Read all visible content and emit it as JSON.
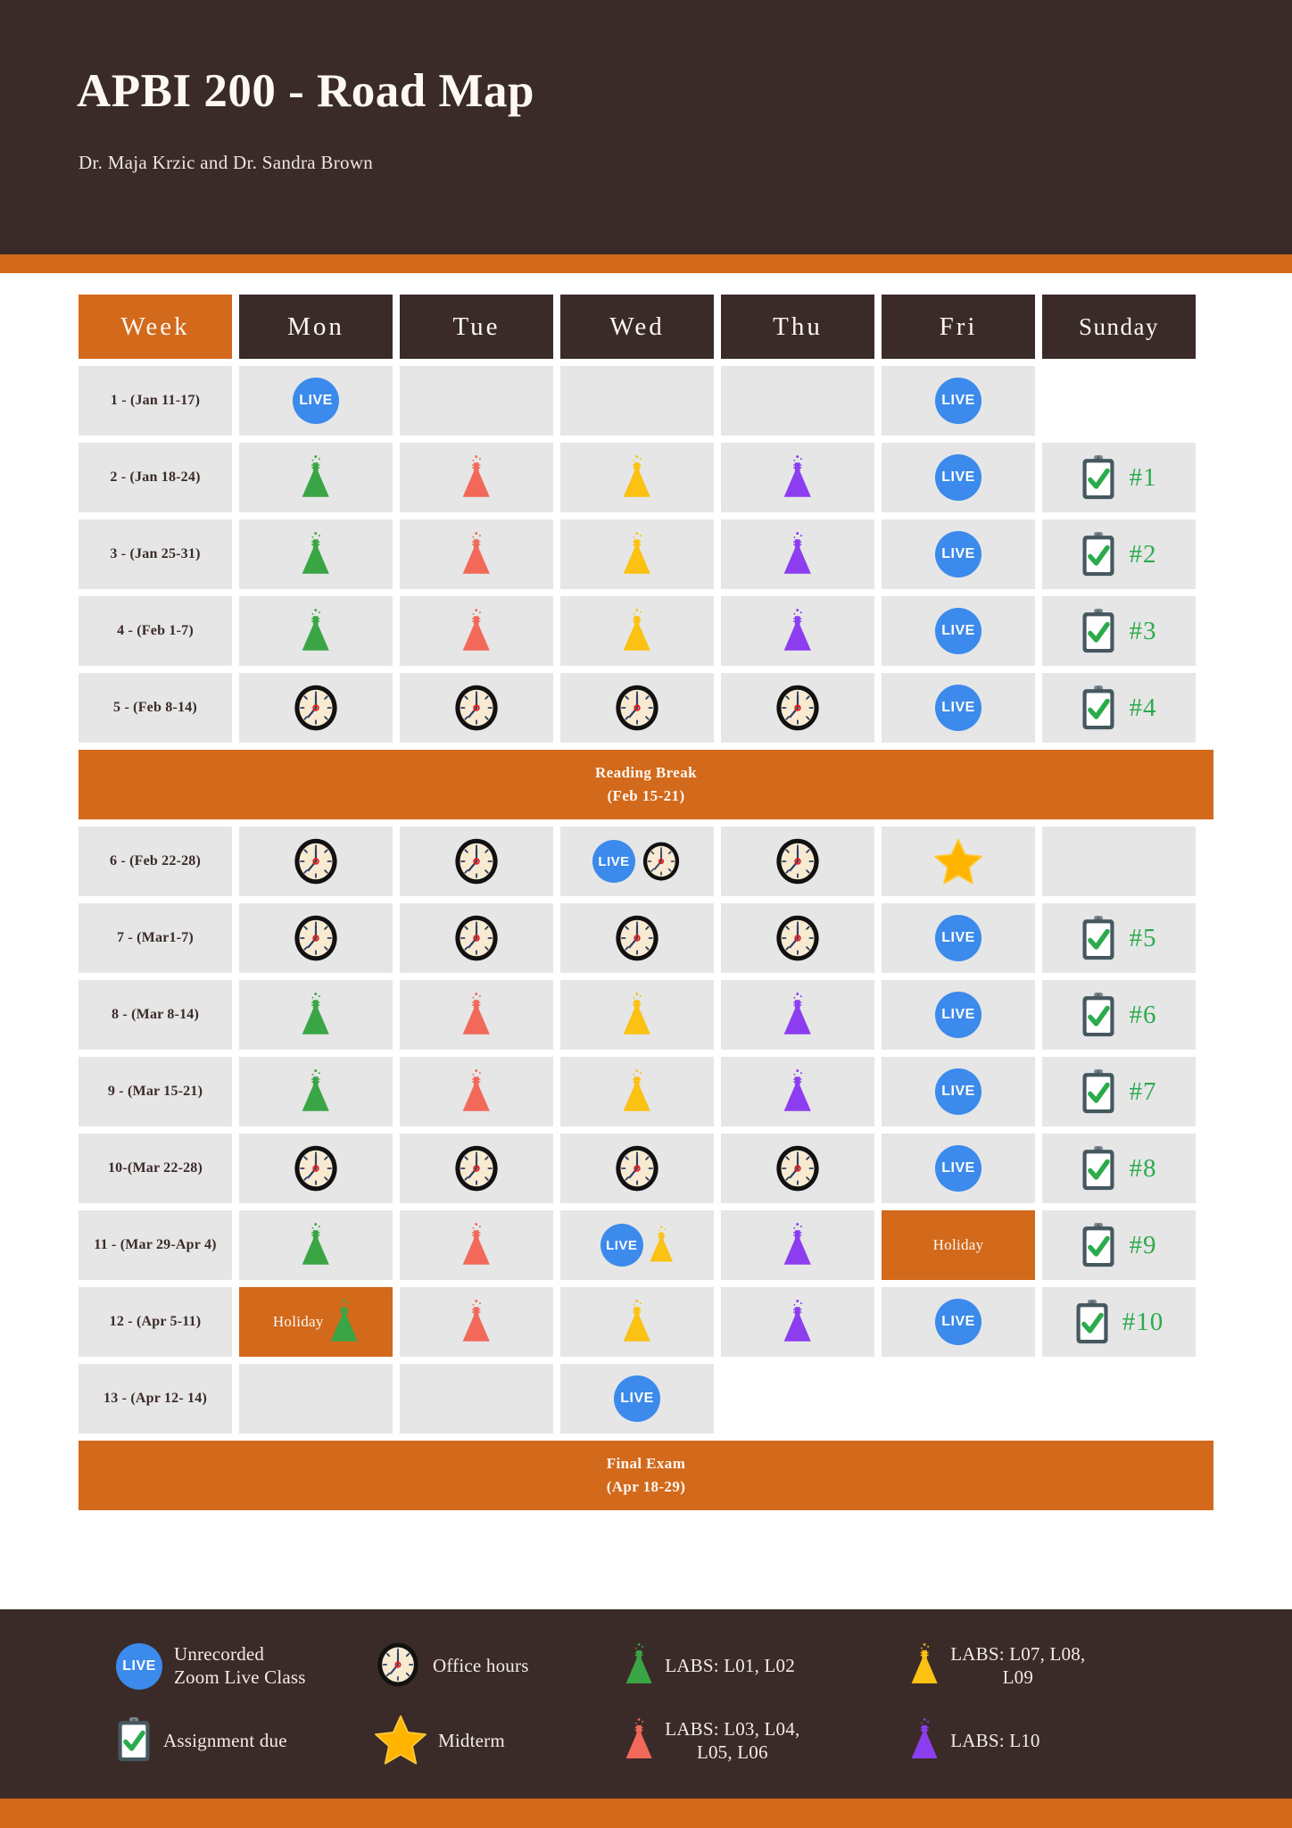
{
  "header": {
    "title": "APBI 200 - Road Map",
    "subtitle": "Dr. Maja Krzic and Dr. Sandra Brown"
  },
  "colors": {
    "brand_dark": "#3b2b28",
    "brand_orange": "#d2691b",
    "cell_gray": "#e6e6e6",
    "live_blue": "#3b8aec",
    "assignment_green": "#2bab4c",
    "flask_green": "#3aa545",
    "flask_red": "#f2695a",
    "flask_yellow": "#fbc113",
    "flask_purple": "#8c3df0",
    "star_yellow": "#ffb400"
  },
  "table": {
    "columns": [
      "Week",
      "Mon",
      "Tue",
      "Wed",
      "Thu",
      "Fri",
      "Sunday"
    ],
    "rows": [
      {
        "week": "1 - (Jan 11-17)",
        "cells": [
          {
            "icons": [
              "live"
            ]
          },
          {
            "icons": []
          },
          {
            "icons": []
          },
          {
            "icons": []
          },
          {
            "icons": [
              "live"
            ]
          },
          {
            "icons": [],
            "blank": true
          }
        ]
      },
      {
        "week": "2 - (Jan 18-24)",
        "cells": [
          {
            "icons": [
              "flask-green"
            ]
          },
          {
            "icons": [
              "flask-red"
            ]
          },
          {
            "icons": [
              "flask-yellow"
            ]
          },
          {
            "icons": [
              "flask-purple"
            ]
          },
          {
            "icons": [
              "live"
            ]
          },
          {
            "icons": [
              "clipboard"
            ],
            "assignment": "#1"
          }
        ]
      },
      {
        "week": "3 - (Jan 25-31)",
        "cells": [
          {
            "icons": [
              "flask-green"
            ]
          },
          {
            "icons": [
              "flask-red"
            ]
          },
          {
            "icons": [
              "flask-yellow"
            ]
          },
          {
            "icons": [
              "flask-purple"
            ]
          },
          {
            "icons": [
              "live"
            ]
          },
          {
            "icons": [
              "clipboard"
            ],
            "assignment": "#2"
          }
        ]
      },
      {
        "week": "4 - (Feb 1-7)",
        "cells": [
          {
            "icons": [
              "flask-green"
            ]
          },
          {
            "icons": [
              "flask-red"
            ]
          },
          {
            "icons": [
              "flask-yellow"
            ]
          },
          {
            "icons": [
              "flask-purple"
            ]
          },
          {
            "icons": [
              "live"
            ]
          },
          {
            "icons": [
              "clipboard"
            ],
            "assignment": "#3"
          }
        ]
      },
      {
        "week": "5 - (Feb 8-14)",
        "cells": [
          {
            "icons": [
              "clock"
            ]
          },
          {
            "icons": [
              "clock"
            ]
          },
          {
            "icons": [
              "clock"
            ]
          },
          {
            "icons": [
              "clock"
            ]
          },
          {
            "icons": [
              "live"
            ]
          },
          {
            "icons": [
              "clipboard"
            ],
            "assignment": "#4"
          }
        ]
      }
    ],
    "reading_break": {
      "line1": "Reading Break",
      "line2": "(Feb 15-21)"
    },
    "rows2": [
      {
        "week": "6 - (Feb 22-28)",
        "cells": [
          {
            "icons": [
              "clock"
            ]
          },
          {
            "icons": [
              "clock"
            ]
          },
          {
            "icons": [
              "live",
              "clock"
            ]
          },
          {
            "icons": [
              "clock"
            ]
          },
          {
            "icons": [
              "star"
            ]
          },
          {
            "icons": []
          }
        ]
      },
      {
        "week": "7 - (Mar1-7)",
        "cells": [
          {
            "icons": [
              "clock"
            ]
          },
          {
            "icons": [
              "clock"
            ]
          },
          {
            "icons": [
              "clock"
            ]
          },
          {
            "icons": [
              "clock"
            ]
          },
          {
            "icons": [
              "live"
            ]
          },
          {
            "icons": [
              "clipboard"
            ],
            "assignment": "#5"
          }
        ]
      },
      {
        "week": "8 - (Mar 8-14)",
        "cells": [
          {
            "icons": [
              "flask-green"
            ]
          },
          {
            "icons": [
              "flask-red"
            ]
          },
          {
            "icons": [
              "flask-yellow"
            ]
          },
          {
            "icons": [
              "flask-purple"
            ]
          },
          {
            "icons": [
              "live"
            ]
          },
          {
            "icons": [
              "clipboard"
            ],
            "assignment": "#6"
          }
        ]
      },
      {
        "week": "9 - (Mar 15-21)",
        "cells": [
          {
            "icons": [
              "flask-green"
            ]
          },
          {
            "icons": [
              "flask-red"
            ]
          },
          {
            "icons": [
              "flask-yellow"
            ]
          },
          {
            "icons": [
              "flask-purple"
            ]
          },
          {
            "icons": [
              "live"
            ]
          },
          {
            "icons": [
              "clipboard"
            ],
            "assignment": "#7"
          }
        ]
      },
      {
        "week": "10-(Mar 22-28)",
        "cells": [
          {
            "icons": [
              "clock"
            ]
          },
          {
            "icons": [
              "clock"
            ]
          },
          {
            "icons": [
              "clock"
            ]
          },
          {
            "icons": [
              "clock"
            ]
          },
          {
            "icons": [
              "live"
            ]
          },
          {
            "icons": [
              "clipboard"
            ],
            "assignment": "#8"
          }
        ]
      },
      {
        "week": "11 - (Mar 29-Apr 4)",
        "cells": [
          {
            "icons": [
              "flask-green"
            ]
          },
          {
            "icons": [
              "flask-red"
            ]
          },
          {
            "icons": [
              "live",
              "flask-yellow"
            ]
          },
          {
            "icons": [
              "flask-purple"
            ]
          },
          {
            "icons": [],
            "holiday": "Holiday"
          },
          {
            "icons": [
              "clipboard"
            ],
            "assignment": "#9"
          }
        ]
      },
      {
        "week": "12 - (Apr 5-11)",
        "cells": [
          {
            "icons": [
              "flask-green"
            ],
            "holiday": "Holiday"
          },
          {
            "icons": [
              "flask-red"
            ]
          },
          {
            "icons": [
              "flask-yellow"
            ]
          },
          {
            "icons": [
              "flask-purple"
            ]
          },
          {
            "icons": [
              "live"
            ]
          },
          {
            "icons": [
              "clipboard"
            ],
            "assignment": "#10"
          }
        ]
      },
      {
        "week": "13 - (Apr 12- 14)",
        "cells": [
          {
            "icons": []
          },
          {
            "icons": []
          },
          {
            "icons": [
              "live"
            ]
          },
          {
            "icons": [],
            "blank": true
          },
          {
            "icons": [],
            "blank": true
          },
          {
            "icons": [],
            "blank": true
          }
        ]
      }
    ],
    "final_exam": {
      "line1": "Final Exam",
      "line2": "(Apr 18-29)"
    }
  },
  "legend": [
    {
      "icon": "live-icon",
      "label": "Unrecorded\nZoom Live Class"
    },
    {
      "icon": "clock-icon",
      "label": "Office hours"
    },
    {
      "icon": "flask-green-icon",
      "label": "LABS: L01, L02"
    },
    {
      "icon": "flask-yellow-icon",
      "label": "LABS: L07, L08,\nL09"
    },
    {
      "icon": "clipboard-icon",
      "label": "Assignment due"
    },
    {
      "icon": "star-icon",
      "label": "Midterm"
    },
    {
      "icon": "flask-red-icon",
      "label": "LABS: L03, L04,\nL05, L06"
    },
    {
      "icon": "flask-purple-icon",
      "label": "LABS: L10"
    }
  ],
  "live_text": "LIVE"
}
